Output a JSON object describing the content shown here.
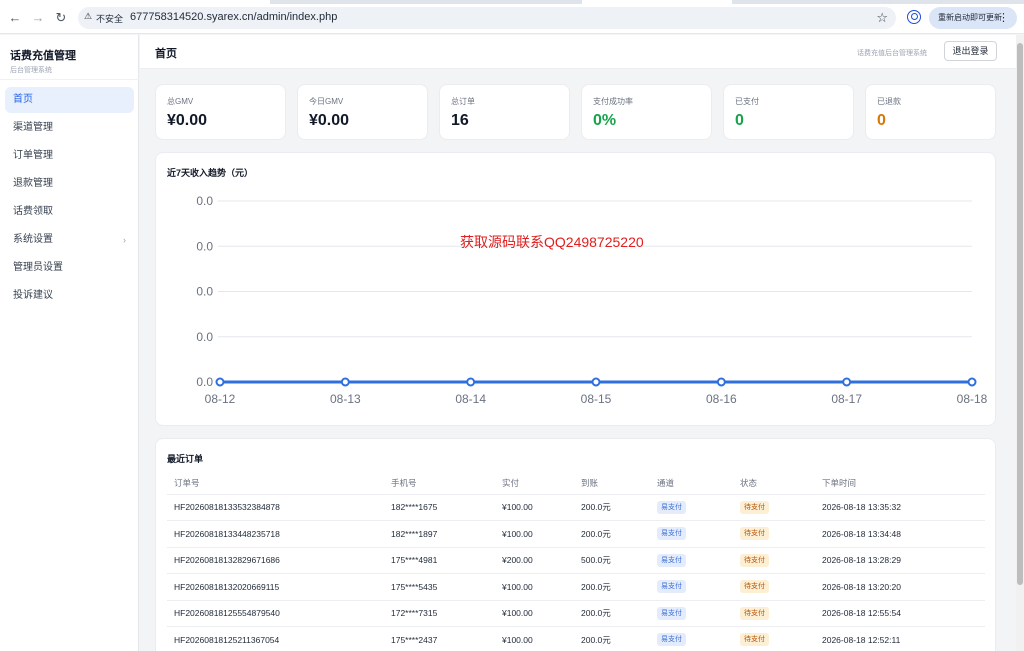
{
  "browser": {
    "security_label": "不安全",
    "url": "677758314520.syarex.cn/admin/index.php",
    "restart_label": "重新启动即可更新"
  },
  "sidebar": {
    "brand_title": "话费充值管理",
    "brand_subtitle": "后台管理系统",
    "items": [
      {
        "label": "首页",
        "active": true
      },
      {
        "label": "渠道管理"
      },
      {
        "label": "订单管理"
      },
      {
        "label": "退款管理"
      },
      {
        "label": "话费领取"
      },
      {
        "label": "系统设置",
        "has_submenu": true
      },
      {
        "label": "管理员设置"
      },
      {
        "label": "投诉建议"
      }
    ]
  },
  "header": {
    "title": "首页",
    "subtitle": "话费充值后台管理系统",
    "logout_label": "退出登录"
  },
  "stats": [
    {
      "label": "总GMV",
      "value": "¥0.00",
      "color": "#111827"
    },
    {
      "label": "今日GMV",
      "value": "¥0.00",
      "color": "#111827"
    },
    {
      "label": "总订单",
      "value": "16",
      "color": "#111827"
    },
    {
      "label": "支付成功率",
      "value": "0%",
      "color": "#16a34a"
    },
    {
      "label": "已支付",
      "value": "0",
      "color": "#16a34a"
    },
    {
      "label": "已退款",
      "value": "0",
      "color": "#d97706"
    }
  ],
  "chart_data": {
    "type": "line",
    "title": "近7天收入趋势（元）",
    "x": [
      "08-12",
      "08-13",
      "08-14",
      "08-15",
      "08-16",
      "08-17",
      "08-18"
    ],
    "series": [
      {
        "values": [
          0,
          0,
          0,
          0,
          0,
          0,
          0
        ]
      }
    ],
    "y_tick_labels": [
      "0.0",
      "0.0",
      "0.0",
      "0.0",
      "0.0"
    ],
    "grid": true,
    "line_color": "#2f6fde"
  },
  "watermark": "获取源码联系QQ2498725220",
  "orders": {
    "title": "最近订单",
    "columns": [
      "订单号",
      "手机号",
      "实付",
      "到账",
      "通道",
      "状态",
      "下单时间"
    ],
    "rows": [
      [
        "HF20260818133532384878",
        "182****1675",
        "¥100.00",
        "200.0元",
        "易支付",
        "待支付",
        "2026-08-18 13:35:32"
      ],
      [
        "HF20260818133448235718",
        "182****1897",
        "¥100.00",
        "200.0元",
        "易支付",
        "待支付",
        "2026-08-18 13:34:48"
      ],
      [
        "HF20260818132829671686",
        "175****4981",
        "¥200.00",
        "500.0元",
        "易支付",
        "待支付",
        "2026-08-18 13:28:29"
      ],
      [
        "HF20260818132020669115",
        "175****5435",
        "¥100.00",
        "200.0元",
        "易支付",
        "待支付",
        "2026-08-18 13:20:20"
      ],
      [
        "HF20260818125554879540",
        "172****7315",
        "¥100.00",
        "200.0元",
        "易支付",
        "待支付",
        "2026-08-18 12:55:54"
      ],
      [
        "HF20260818125211367054",
        "175****2437",
        "¥100.00",
        "200.0元",
        "易支付",
        "待支付",
        "2026-08-18 12:52:11"
      ]
    ]
  }
}
